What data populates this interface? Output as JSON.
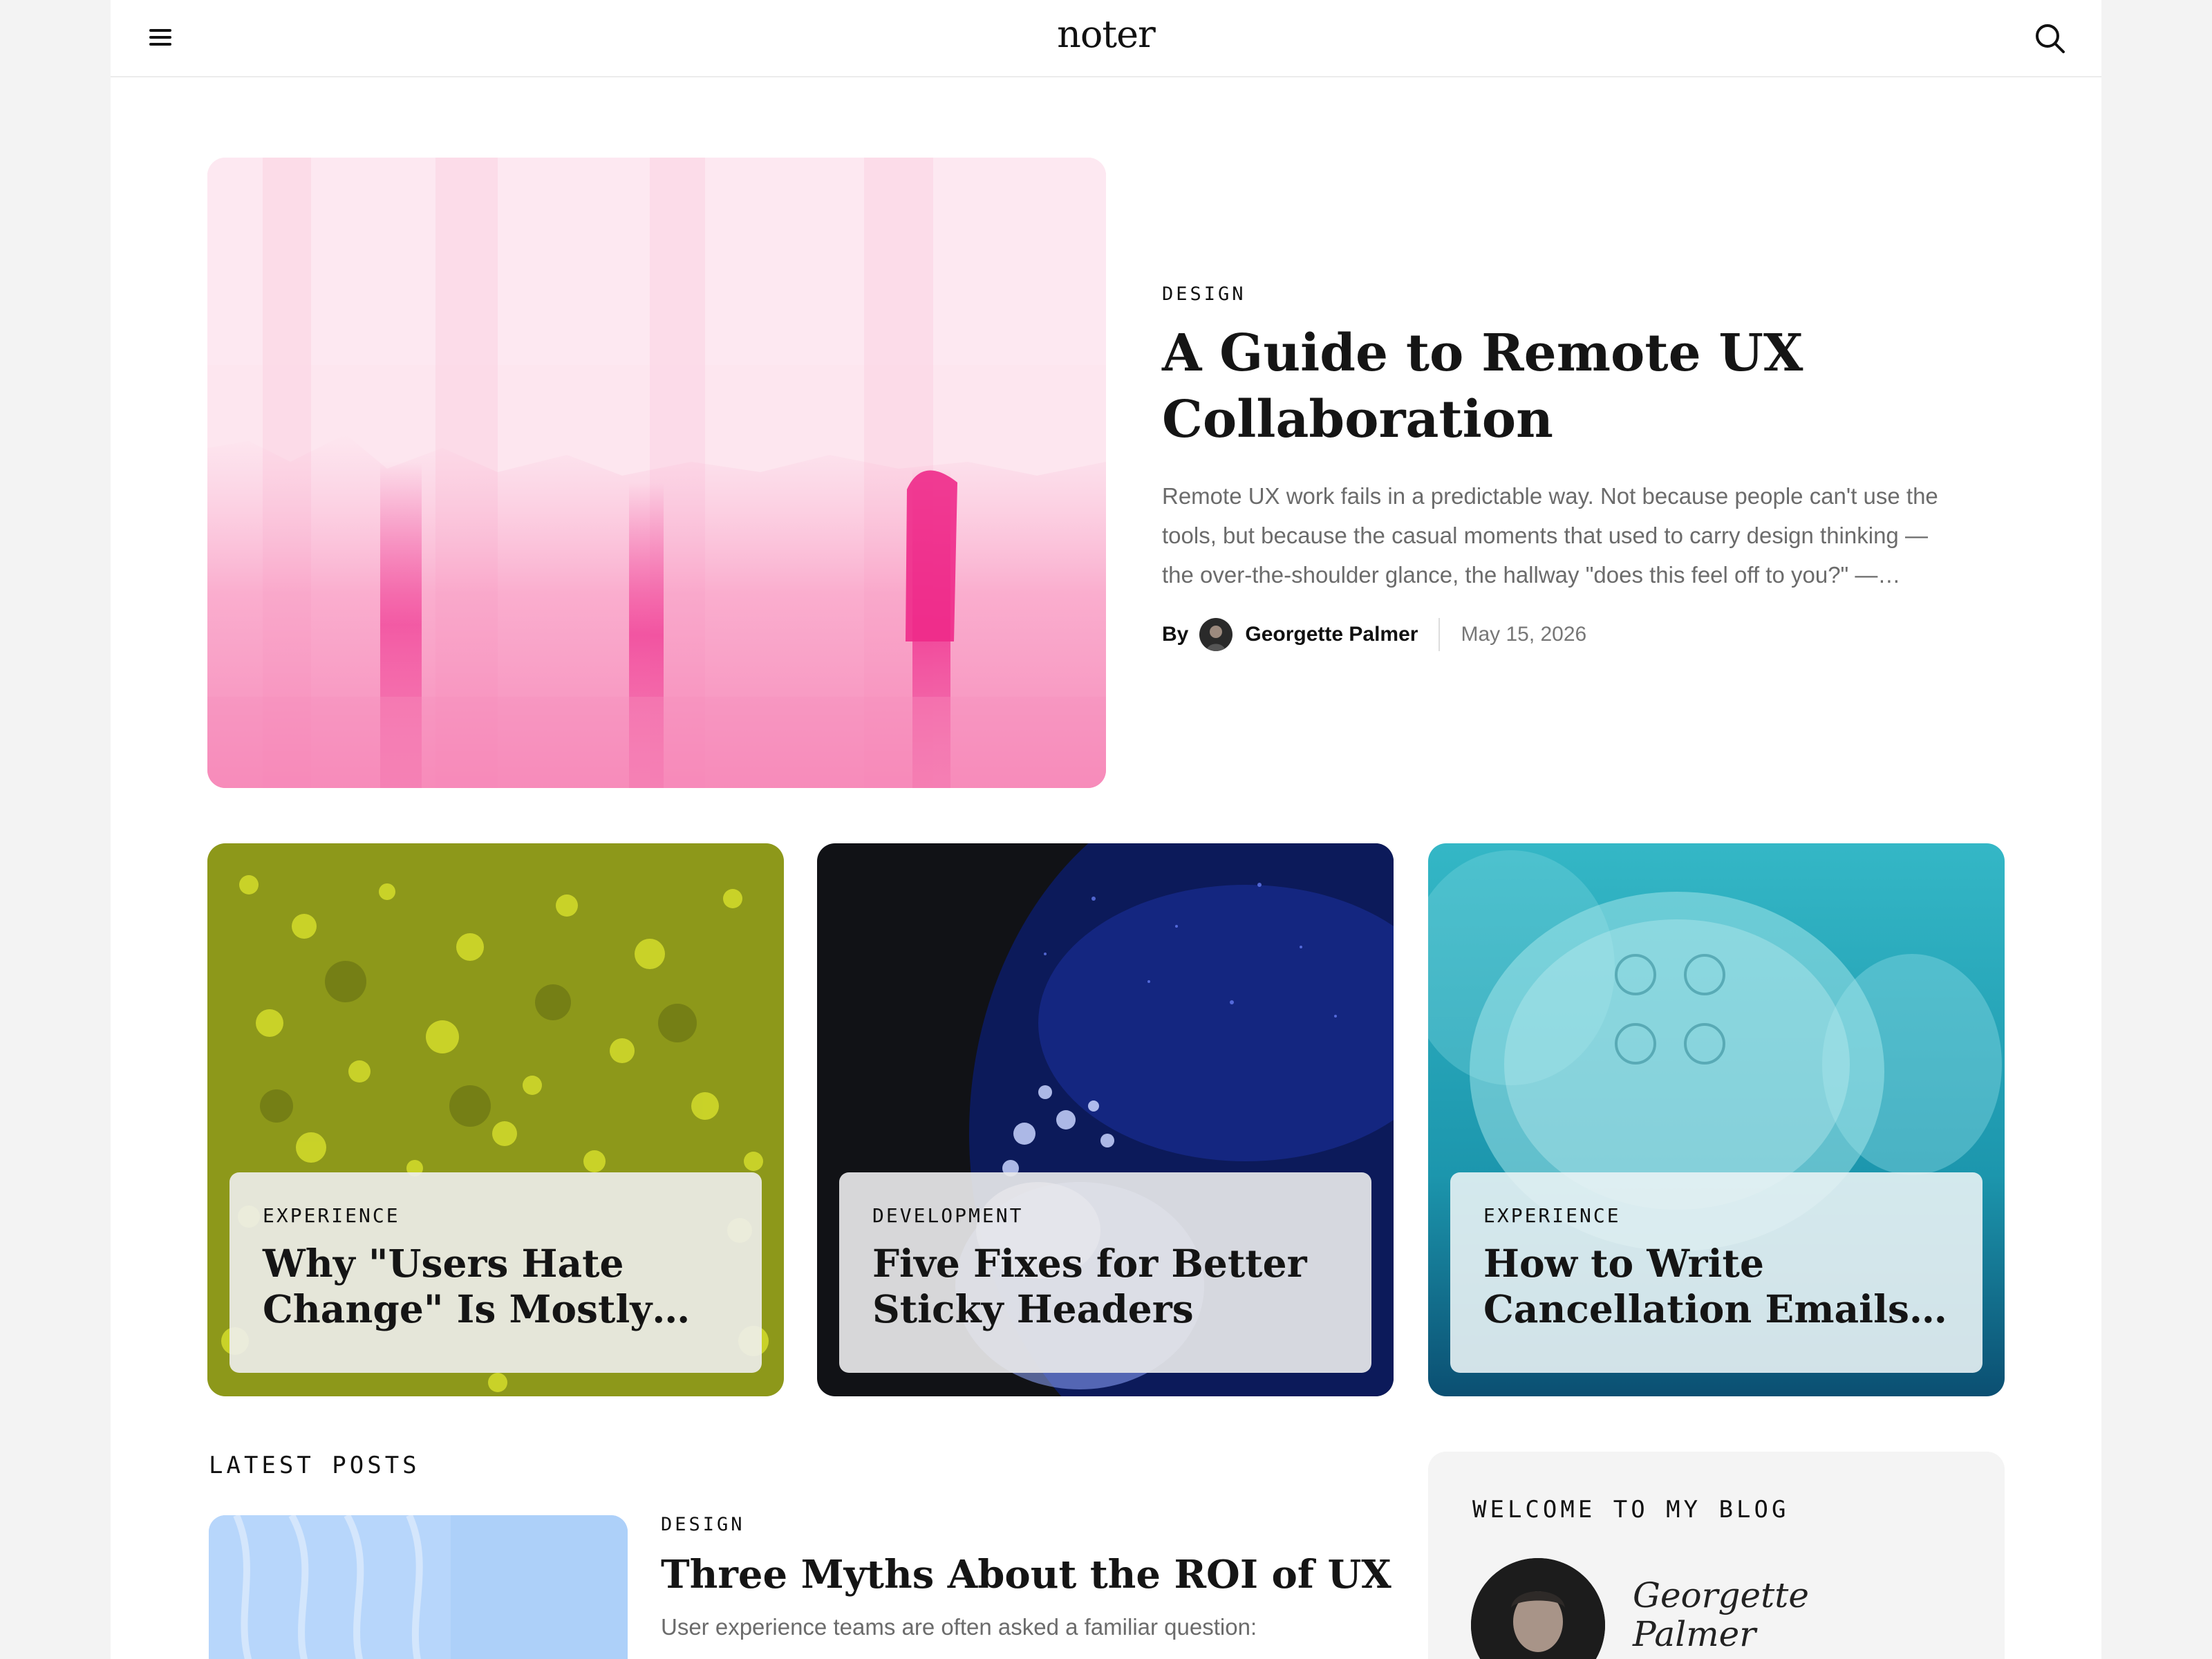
{
  "header": {
    "logo": "noter",
    "menu_icon": "hamburger-menu-icon",
    "search_icon": "search-icon"
  },
  "hero": {
    "category": "DESIGN",
    "title": "A Guide to Remote UX Collaboration",
    "excerpt": "Remote UX work fails in a predictable way. Not because people can't use the tools, but because the casual moments that used to carry design thinking — the over-the-shoulder glance, the hallway \"does this feel off to you?\" —…",
    "by_label": "By",
    "author": "Georgette Palmer",
    "date": "May 15, 2026"
  },
  "featured": [
    {
      "category": "EXPERIENCE",
      "title": "Why \"Users Hate Change\" Is Mostly…"
    },
    {
      "category": "DEVELOPMENT",
      "title": "Five Fixes for Better Sticky Headers"
    },
    {
      "category": "EXPERIENCE",
      "title": "How to Write Cancellation Emails…"
    }
  ],
  "latest": {
    "label": "LATEST POSTS",
    "posts": [
      {
        "category": "DESIGN",
        "title": "Three Myths About the ROI of UX",
        "excerpt": "User experience teams are often asked a familiar question:"
      }
    ]
  },
  "sidebar": {
    "title": "WELCOME TO MY BLOG",
    "name": "Georgette Palmer"
  },
  "colors": {
    "accent_pink": "#f0479a",
    "card_panel_light": "#efefef",
    "text_muted": "#6b6b6b"
  }
}
